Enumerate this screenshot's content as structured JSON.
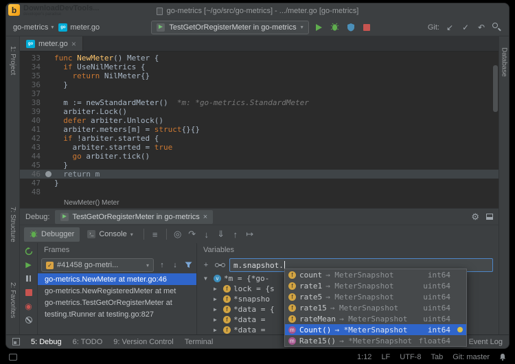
{
  "window": {
    "title": "go-metrics [~/go/src/go-metrics] - .../meter.go [go-metrics]",
    "watermark": {
      "logo_letter": "b",
      "title": "DownloadDevTools...",
      "subtitle": "developer's paradise"
    }
  },
  "toolbar": {
    "project_breadcrumb": "go-metrics",
    "file_breadcrumb": "meter.go",
    "run_config": "TestGetOrRegisterMeter in go-metrics",
    "git_label": "Git:"
  },
  "side_stripes": {
    "left_top": "1: Project",
    "left_bottom": [
      "7: Structure",
      "2: Favorites"
    ],
    "right_top": "Database"
  },
  "editor": {
    "tab_label": "meter.go",
    "breadcrumb": "NewMeter() Meter",
    "current_line": 46,
    "breakpoint_line": 46,
    "lines": [
      {
        "no": 33,
        "indent": 0,
        "tokens": [
          {
            "c": "kw",
            "t": "func "
          },
          {
            "c": "fn",
            "t": "NewMeter"
          },
          {
            "c": "pl",
            "t": "() Meter {"
          }
        ]
      },
      {
        "no": 34,
        "indent": 1,
        "tokens": [
          {
            "c": "kw",
            "t": "if "
          },
          {
            "c": "pl",
            "t": "UseNilMetrics {"
          }
        ]
      },
      {
        "no": 35,
        "indent": 2,
        "tokens": [
          {
            "c": "kw",
            "t": "return "
          },
          {
            "c": "pl",
            "t": "NilMeter{}"
          }
        ]
      },
      {
        "no": 36,
        "indent": 1,
        "tokens": [
          {
            "c": "pl",
            "t": "}"
          }
        ]
      },
      {
        "no": 37,
        "indent": 0,
        "tokens": []
      },
      {
        "no": 38,
        "indent": 1,
        "tokens": [
          {
            "c": "pl",
            "t": "m := newStandardMeter() "
          },
          {
            "c": "hint",
            "t": " *m: *go-metrics.StandardMeter"
          }
        ]
      },
      {
        "no": 39,
        "indent": 1,
        "tokens": [
          {
            "c": "pl",
            "t": "arbiter.Lock()"
          }
        ]
      },
      {
        "no": 40,
        "indent": 1,
        "tokens": [
          {
            "c": "kw",
            "t": "defer "
          },
          {
            "c": "pl",
            "t": "arbiter.Unlock()"
          }
        ]
      },
      {
        "no": 41,
        "indent": 1,
        "tokens": [
          {
            "c": "pl",
            "t": "arbiter.meters[m] = "
          },
          {
            "c": "kw",
            "t": "struct"
          },
          {
            "c": "pl",
            "t": "{}{}"
          }
        ]
      },
      {
        "no": 42,
        "indent": 1,
        "tokens": [
          {
            "c": "kw",
            "t": "if "
          },
          {
            "c": "pl",
            "t": "!arbiter.started {"
          }
        ]
      },
      {
        "no": 43,
        "indent": 2,
        "tokens": [
          {
            "c": "pl",
            "t": "arbiter.started = "
          },
          {
            "c": "kw",
            "t": "true"
          }
        ]
      },
      {
        "no": 44,
        "indent": 2,
        "tokens": [
          {
            "c": "kw",
            "t": "go "
          },
          {
            "c": "pl",
            "t": "arbiter.tick()"
          }
        ]
      },
      {
        "no": 45,
        "indent": 1,
        "tokens": [
          {
            "c": "pl",
            "t": "}"
          }
        ]
      },
      {
        "no": 46,
        "indent": 1,
        "tokens": [
          {
            "c": "kw",
            "t": "return "
          },
          {
            "c": "pl",
            "t": "m"
          }
        ]
      },
      {
        "no": 47,
        "indent": 0,
        "tokens": [
          {
            "c": "pl",
            "t": "}"
          }
        ]
      },
      {
        "no": 48,
        "indent": 0,
        "tokens": []
      }
    ]
  },
  "debug": {
    "panel_label": "Debug:",
    "tab_label": "TestGetOrRegisterMeter in go-metrics",
    "tabs": [
      {
        "label": "Debugger"
      },
      {
        "label": "Console"
      }
    ],
    "frames": {
      "header": "Frames",
      "thread_dropdown": "#41458 go-metri...",
      "items": [
        {
          "label": "go-metrics.NewMeter at meter.go:46",
          "selected": true
        },
        {
          "label": "go-metrics.NewRegisteredMeter at met",
          "selected": false
        },
        {
          "label": "go-metrics.TestGetOrRegisterMeter at",
          "selected": false
        },
        {
          "label": "testing.tRunner at testing.go:827",
          "selected": false
        }
      ]
    },
    "variables": {
      "header": "Variables",
      "watch_input": "m.snapshot.",
      "items": [
        {
          "expanded": true,
          "kind": "v",
          "child": false,
          "text": "*m = {*go-"
        },
        {
          "expanded": false,
          "kind": "f",
          "child": true,
          "text": "lock = {s"
        },
        {
          "expanded": false,
          "kind": "f",
          "child": true,
          "text": "*snapsho"
        },
        {
          "expanded": false,
          "kind": "f",
          "child": true,
          "text": "*data = {"
        },
        {
          "expanded": false,
          "kind": "f",
          "child": true,
          "text": "*data = "
        },
        {
          "expanded": false,
          "kind": "f",
          "child": true,
          "text": "*data ="
        }
      ]
    }
  },
  "completion": {
    "arrow": "→",
    "items": [
      {
        "kind": "f",
        "name": "count",
        "origin": "MeterSnapshot",
        "type": "int64",
        "selected": false
      },
      {
        "kind": "f",
        "name": "rate1",
        "origin": "MeterSnapshot",
        "type": "uint64",
        "selected": false
      },
      {
        "kind": "f",
        "name": "rate5",
        "origin": "MeterSnapshot",
        "type": "uint64",
        "selected": false
      },
      {
        "kind": "f",
        "name": "rate15",
        "origin": "MeterSnapshot",
        "type": "uint64",
        "selected": false
      },
      {
        "kind": "f",
        "name": "rateMean",
        "origin": "MeterSnapshot",
        "type": "uint64",
        "selected": false
      },
      {
        "kind": "m",
        "name": "Count()",
        "origin": "*MeterSnapshot",
        "type": "int64",
        "selected": true
      },
      {
        "kind": "m",
        "name": "Rate15()",
        "origin": "*MeterSnapshot",
        "type": "float64",
        "selected": false
      }
    ]
  },
  "statusbar": {
    "buttons": [
      {
        "label": "5: Debug",
        "active": true,
        "align": "left"
      },
      {
        "label": "6: TODO",
        "active": false,
        "align": "left"
      },
      {
        "label": "9: Version Control",
        "active": false,
        "align": "left"
      },
      {
        "label": "Terminal",
        "active": false,
        "align": "left"
      },
      {
        "label": "Event Log",
        "active": false,
        "align": "right"
      }
    ]
  },
  "infobar": {
    "items": [
      "1:12",
      "LF",
      "UTF-8",
      "Tab",
      "Git: master"
    ]
  },
  "icons": {
    "chevron_down": "▾",
    "expand_open": "▼",
    "expand_closed": "▶",
    "close": "×",
    "gear": "⚙",
    "frame_up": "↑",
    "frame_down": "↓",
    "add": "+",
    "layout": "≡",
    "step_show_exec": "◎",
    "step_over": "↷",
    "step_into": "↓",
    "step_force_into": "⇓",
    "step_out": "↑",
    "run_to_cursor": "↦",
    "resume": "▶",
    "view_breakpoints": "◉",
    "thread_check": "✓",
    "git_update": "↙",
    "git_commit": "✓",
    "git_rollback": "↶",
    "console_prompt": "›_",
    "go_badge": "go",
    "field_badge": "f",
    "method_badge": "m",
    "variable_badge": "v"
  }
}
